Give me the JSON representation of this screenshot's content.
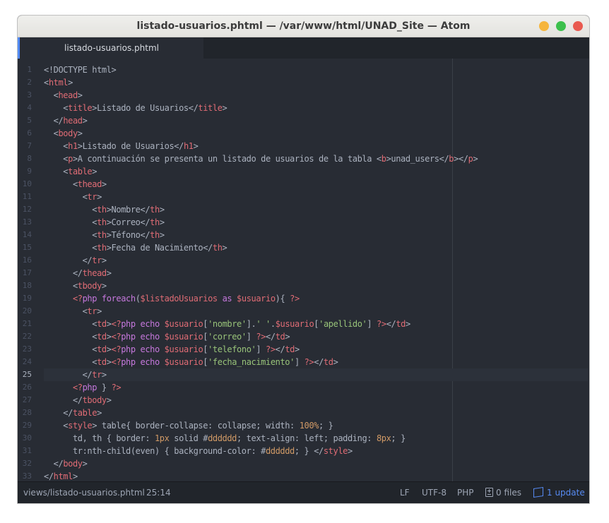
{
  "window": {
    "title": "listado-usuarios.phtml — /var/www/html/UNAD_Site — Atom"
  },
  "tab": {
    "label": "listado-usuarios.phtml"
  },
  "editor": {
    "current_line": 25,
    "lines": [
      {
        "n": "1",
        "text": "<!DOCTYPE html>"
      },
      {
        "n": "2",
        "text": "<html>"
      },
      {
        "n": "3",
        "text": "  <head>"
      },
      {
        "n": "4",
        "text": "    <title>Listado de Usuarios</title>"
      },
      {
        "n": "5",
        "text": "  </head>"
      },
      {
        "n": "6",
        "text": "  <body>"
      },
      {
        "n": "7",
        "text": "    <h1>Listado de Usuarios</h1>"
      },
      {
        "n": "8",
        "text": "    <p>A continuación se presenta un listado de usuarios de la tabla <b>unad_users</b></p>"
      },
      {
        "n": "9",
        "text": "    <table>"
      },
      {
        "n": "10",
        "text": "      <thead>"
      },
      {
        "n": "11",
        "text": "        <tr>"
      },
      {
        "n": "12",
        "text": "          <th>Nombre</th>"
      },
      {
        "n": "13",
        "text": "          <th>Correo</th>"
      },
      {
        "n": "14",
        "text": "          <th>Téfono</th>"
      },
      {
        "n": "15",
        "text": "          <th>Fecha de Nacimiento</th>"
      },
      {
        "n": "16",
        "text": "        </tr>"
      },
      {
        "n": "17",
        "text": "      </thead>"
      },
      {
        "n": "18",
        "text": "      <tbody>"
      },
      {
        "n": "19",
        "text": "      <?php foreach($listadoUsuarios as $usuario){ ?>"
      },
      {
        "n": "20",
        "text": "        <tr>"
      },
      {
        "n": "21",
        "text": "          <td><?php echo $usuario['nombre'].' '.$usuario['apellido'] ?></td>"
      },
      {
        "n": "22",
        "text": "          <td><?php echo $usuario['correo'] ?></td>"
      },
      {
        "n": "23",
        "text": "          <td><?php echo $usuario['telefono'] ?></td>"
      },
      {
        "n": "24",
        "text": "          <td><?php echo $usuario['fecha_nacimiento'] ?></td>"
      },
      {
        "n": "25",
        "text": "        </tr>"
      },
      {
        "n": "26",
        "text": "      <?php } ?>"
      },
      {
        "n": "27",
        "text": "      </tbody>"
      },
      {
        "n": "28",
        "text": "    </table>"
      },
      {
        "n": "29",
        "text": "    <style> table{ border-collapse: collapse; width: 100%; }"
      },
      {
        "n": "30",
        "text": "      td, th { border: 1px solid #dddddd; text-align: left; padding: 8px; }"
      },
      {
        "n": "31",
        "text": "      tr:nth-child(even) { background-color: #dddddd; } </style>"
      },
      {
        "n": "32",
        "text": "  </body>"
      },
      {
        "n": "33",
        "text": "</html>"
      }
    ]
  },
  "statusbar": {
    "file_path": "views/listado-usuarios.phtml",
    "cursor": "25:14",
    "line_ending": "LF",
    "encoding": "UTF-8",
    "grammar": "PHP",
    "git_files": "0 files",
    "updates": "1 update"
  },
  "colors": {
    "background": "#282c34",
    "tag": "#e06c75",
    "attribute_value": "#98c379",
    "keyword": "#c678dd",
    "number": "#d19a66",
    "accent": "#528bff",
    "update": "#568af2"
  }
}
